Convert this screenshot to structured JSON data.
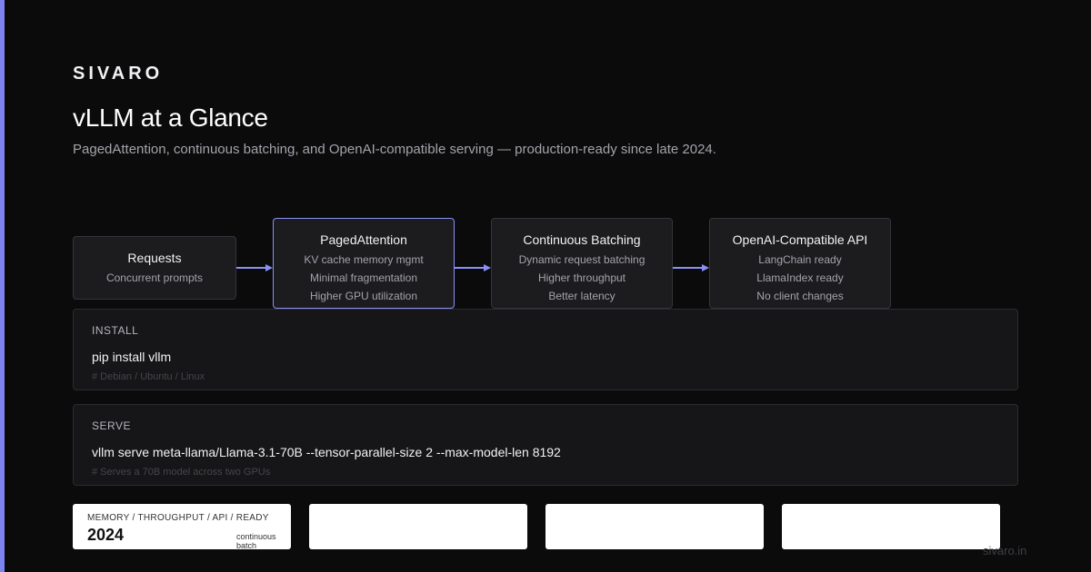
{
  "brand": "SIVARO",
  "title": "vLLM at a Glance",
  "subtitle": "PagedAttention, continuous batching, and OpenAI-compatible serving — production-ready since late 2024.",
  "flow": {
    "nodes": [
      {
        "title": "Requests",
        "lines": [
          "Concurrent prompts"
        ]
      },
      {
        "title": "PagedAttention",
        "lines": [
          "KV cache memory mgmt",
          "Minimal fragmentation",
          "Higher GPU utilization"
        ]
      },
      {
        "title": "Continuous Batching",
        "lines": [
          "Dynamic request batching",
          "Higher throughput",
          "Better latency"
        ]
      },
      {
        "title": "OpenAI-Compatible API",
        "lines": [
          "LangChain ready",
          "LlamaIndex ready",
          "No client changes"
        ]
      }
    ]
  },
  "install": {
    "label": "INSTALL",
    "command": "pip install vllm",
    "note": "# Debian / Ubuntu / Linux"
  },
  "serve": {
    "label": "SERVE",
    "command": "vllm serve meta-llama/Llama-3.1-70B --tensor-parallel-size 2 --max-model-len 8192",
    "note": "# Serves a 70B model across two GPUs"
  },
  "stats": [
    {
      "label": "MEMORY / THROUGHPUT / API / READY",
      "value": "2024",
      "unit": "continuous batch"
    },
    {
      "label": "",
      "value": "",
      "unit": ""
    },
    {
      "label": "",
      "value": "",
      "unit": ""
    },
    {
      "label": "",
      "value": "",
      "unit": ""
    }
  ],
  "footer": "sivaro.in",
  "colors": {
    "accent": "#8a90f5",
    "background": "#0b0b0c",
    "card": "#1c1c1f"
  }
}
